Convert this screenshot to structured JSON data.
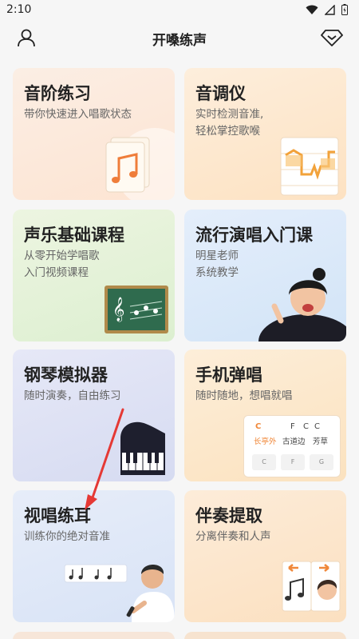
{
  "status_bar": {
    "time": "2:10"
  },
  "header": {
    "title": "开嗓练声"
  },
  "cards": [
    {
      "title": "音阶练习",
      "subtitle_lines": [
        "带你快速进入唱歌状态"
      ]
    },
    {
      "title": "音调仪",
      "subtitle_lines": [
        "实时检测音准,",
        "轻松掌控歌喉"
      ]
    },
    {
      "title": "声乐基础课程",
      "subtitle_lines": [
        "从零开始学唱歌",
        "入门视频课程"
      ]
    },
    {
      "title": "流行演唱入门课",
      "subtitle_lines": [
        "明星老师",
        "系统教学"
      ]
    },
    {
      "title": "钢琴模拟器",
      "subtitle_lines": [
        "随时演奏，自由练习"
      ]
    },
    {
      "title": "手机弹唱",
      "subtitle_lines": [
        "随时随地，想唱就唱"
      ]
    },
    {
      "title": "视唱练耳",
      "subtitle_lines": [
        "训练你的绝对音准"
      ]
    },
    {
      "title": "伴奏提取",
      "subtitle_lines": [
        "分离伴奏和人声"
      ]
    }
  ],
  "chord_card": {
    "chords": [
      "C",
      "F",
      "C",
      "C"
    ],
    "lyrics": [
      "长亭外",
      "古道边",
      "芳草"
    ],
    "keys": [
      "C",
      "F",
      "G"
    ]
  },
  "colors": {
    "accent_orange": "#f0883a",
    "annotation_red": "#e53935"
  },
  "icons": {
    "user": "user-icon",
    "vip": "diamond-icon",
    "wifi": "wifi-icon",
    "battery": "battery-icon"
  }
}
